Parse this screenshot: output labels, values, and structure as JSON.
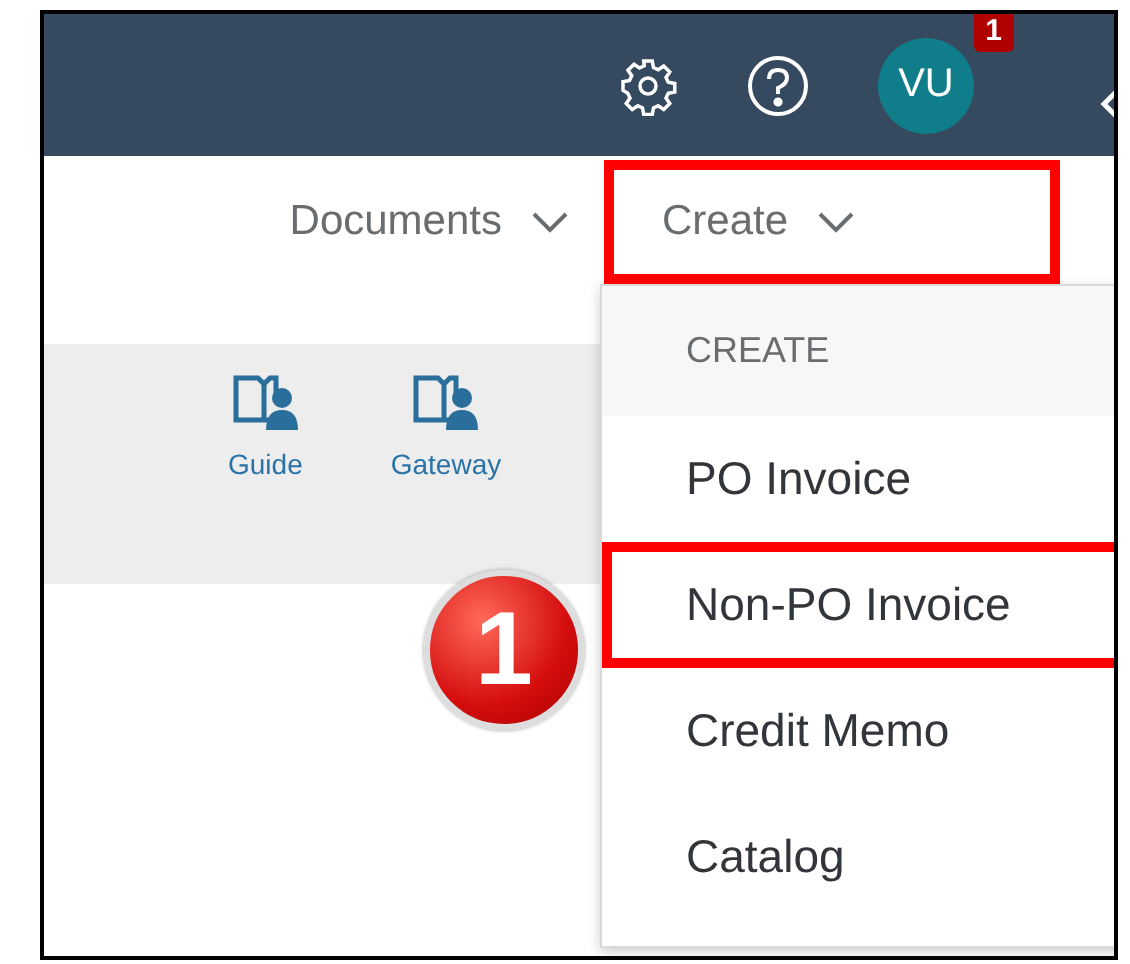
{
  "header": {
    "avatar_initials": "VU",
    "notification_count": "1"
  },
  "nav": [
    {
      "label": "Documents",
      "highlighted": false
    },
    {
      "label": "Create",
      "highlighted": true
    }
  ],
  "quick_links": [
    {
      "label": "Guide"
    },
    {
      "label": "Gateway"
    }
  ],
  "step_marker": "1",
  "create_menu": {
    "heading": "CREATE",
    "items": [
      {
        "label": "PO Invoice",
        "highlighted": false
      },
      {
        "label": "Non-PO Invoice",
        "highlighted": true
      },
      {
        "label": "Credit Memo",
        "highlighted": false
      },
      {
        "label": "Catalog",
        "highlighted": false
      }
    ]
  }
}
